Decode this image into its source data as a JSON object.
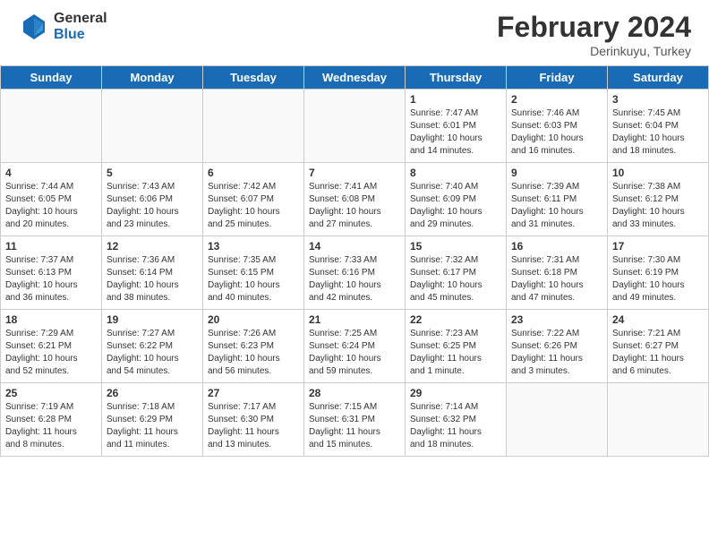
{
  "header": {
    "logo_general": "General",
    "logo_blue": "Blue",
    "title": "February 2024",
    "subtitle": "Derinkuyu, Turkey"
  },
  "weekdays": [
    "Sunday",
    "Monday",
    "Tuesday",
    "Wednesday",
    "Thursday",
    "Friday",
    "Saturday"
  ],
  "weeks": [
    [
      {
        "day": "",
        "info": ""
      },
      {
        "day": "",
        "info": ""
      },
      {
        "day": "",
        "info": ""
      },
      {
        "day": "",
        "info": ""
      },
      {
        "day": "1",
        "info": "Sunrise: 7:47 AM\nSunset: 6:01 PM\nDaylight: 10 hours\nand 14 minutes."
      },
      {
        "day": "2",
        "info": "Sunrise: 7:46 AM\nSunset: 6:03 PM\nDaylight: 10 hours\nand 16 minutes."
      },
      {
        "day": "3",
        "info": "Sunrise: 7:45 AM\nSunset: 6:04 PM\nDaylight: 10 hours\nand 18 minutes."
      }
    ],
    [
      {
        "day": "4",
        "info": "Sunrise: 7:44 AM\nSunset: 6:05 PM\nDaylight: 10 hours\nand 20 minutes."
      },
      {
        "day": "5",
        "info": "Sunrise: 7:43 AM\nSunset: 6:06 PM\nDaylight: 10 hours\nand 23 minutes."
      },
      {
        "day": "6",
        "info": "Sunrise: 7:42 AM\nSunset: 6:07 PM\nDaylight: 10 hours\nand 25 minutes."
      },
      {
        "day": "7",
        "info": "Sunrise: 7:41 AM\nSunset: 6:08 PM\nDaylight: 10 hours\nand 27 minutes."
      },
      {
        "day": "8",
        "info": "Sunrise: 7:40 AM\nSunset: 6:09 PM\nDaylight: 10 hours\nand 29 minutes."
      },
      {
        "day": "9",
        "info": "Sunrise: 7:39 AM\nSunset: 6:11 PM\nDaylight: 10 hours\nand 31 minutes."
      },
      {
        "day": "10",
        "info": "Sunrise: 7:38 AM\nSunset: 6:12 PM\nDaylight: 10 hours\nand 33 minutes."
      }
    ],
    [
      {
        "day": "11",
        "info": "Sunrise: 7:37 AM\nSunset: 6:13 PM\nDaylight: 10 hours\nand 36 minutes."
      },
      {
        "day": "12",
        "info": "Sunrise: 7:36 AM\nSunset: 6:14 PM\nDaylight: 10 hours\nand 38 minutes."
      },
      {
        "day": "13",
        "info": "Sunrise: 7:35 AM\nSunset: 6:15 PM\nDaylight: 10 hours\nand 40 minutes."
      },
      {
        "day": "14",
        "info": "Sunrise: 7:33 AM\nSunset: 6:16 PM\nDaylight: 10 hours\nand 42 minutes."
      },
      {
        "day": "15",
        "info": "Sunrise: 7:32 AM\nSunset: 6:17 PM\nDaylight: 10 hours\nand 45 minutes."
      },
      {
        "day": "16",
        "info": "Sunrise: 7:31 AM\nSunset: 6:18 PM\nDaylight: 10 hours\nand 47 minutes."
      },
      {
        "day": "17",
        "info": "Sunrise: 7:30 AM\nSunset: 6:19 PM\nDaylight: 10 hours\nand 49 minutes."
      }
    ],
    [
      {
        "day": "18",
        "info": "Sunrise: 7:29 AM\nSunset: 6:21 PM\nDaylight: 10 hours\nand 52 minutes."
      },
      {
        "day": "19",
        "info": "Sunrise: 7:27 AM\nSunset: 6:22 PM\nDaylight: 10 hours\nand 54 minutes."
      },
      {
        "day": "20",
        "info": "Sunrise: 7:26 AM\nSunset: 6:23 PM\nDaylight: 10 hours\nand 56 minutes."
      },
      {
        "day": "21",
        "info": "Sunrise: 7:25 AM\nSunset: 6:24 PM\nDaylight: 10 hours\nand 59 minutes."
      },
      {
        "day": "22",
        "info": "Sunrise: 7:23 AM\nSunset: 6:25 PM\nDaylight: 11 hours\nand 1 minute."
      },
      {
        "day": "23",
        "info": "Sunrise: 7:22 AM\nSunset: 6:26 PM\nDaylight: 11 hours\nand 3 minutes."
      },
      {
        "day": "24",
        "info": "Sunrise: 7:21 AM\nSunset: 6:27 PM\nDaylight: 11 hours\nand 6 minutes."
      }
    ],
    [
      {
        "day": "25",
        "info": "Sunrise: 7:19 AM\nSunset: 6:28 PM\nDaylight: 11 hours\nand 8 minutes."
      },
      {
        "day": "26",
        "info": "Sunrise: 7:18 AM\nSunset: 6:29 PM\nDaylight: 11 hours\nand 11 minutes."
      },
      {
        "day": "27",
        "info": "Sunrise: 7:17 AM\nSunset: 6:30 PM\nDaylight: 11 hours\nand 13 minutes."
      },
      {
        "day": "28",
        "info": "Sunrise: 7:15 AM\nSunset: 6:31 PM\nDaylight: 11 hours\nand 15 minutes."
      },
      {
        "day": "29",
        "info": "Sunrise: 7:14 AM\nSunset: 6:32 PM\nDaylight: 11 hours\nand 18 minutes."
      },
      {
        "day": "",
        "info": ""
      },
      {
        "day": "",
        "info": ""
      }
    ]
  ]
}
